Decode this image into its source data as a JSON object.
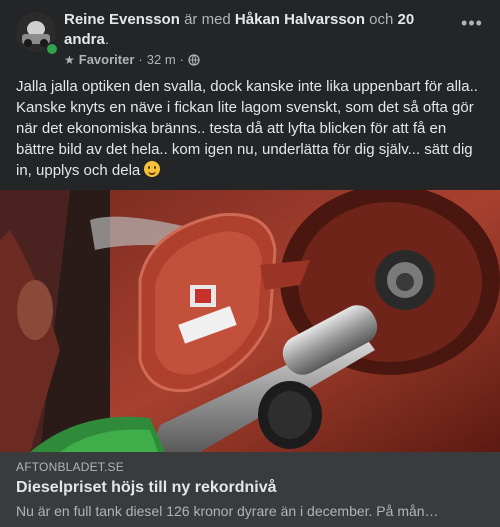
{
  "post": {
    "author": "Reine Evensson",
    "with_text": "är med",
    "tagged": "Håkan Halvarsson",
    "and_text": "och",
    "others": "20 andra",
    "period": ".",
    "audience": "Favoriter",
    "dot": "·",
    "time": "32 m",
    "dot2": "·",
    "more_icon": "more-options",
    "body": "Jalla jalla optiken den svalla, dock kanske inte lika uppenbart för alla.. Kanske knyts en näve i fickan lite lagom svenskt, som det så ofta gör när det ekonomiska bränns.. testa då att lyfta blicken för att få en bättre bild av det hela.. kom igen nu, underlätta för dig själv... sätt dig in, upplys och dela"
  },
  "link": {
    "domain": "AFTONBLADET.SE",
    "title": "Dieselpriset höjs till ny rekordnivå",
    "description": "Nu är en full tank diesel 126 kronor dyrare än i december. På mån…"
  },
  "colors": {
    "background": "#242526",
    "link_box": "#3a3b3c",
    "online": "#31a24c"
  }
}
